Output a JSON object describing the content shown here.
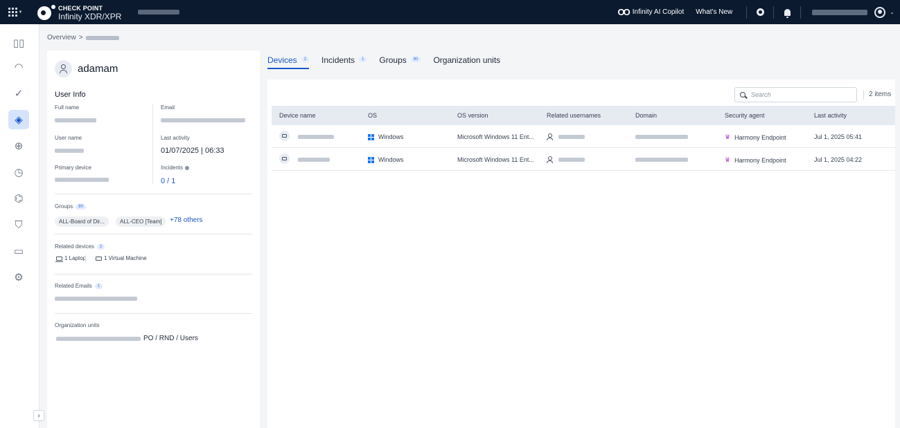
{
  "topbar": {
    "brand_name": "CHECK POINT",
    "product": "Infinity XDR/XPR",
    "copilot_label": "Infinity AI Copilot",
    "whats_new_label": "What's New"
  },
  "breadcrumb": {
    "root": "Overview",
    "separator": ">"
  },
  "user": {
    "name": "adamam",
    "info_title": "User Info",
    "labels": {
      "full_name": "Full name",
      "email": "Email",
      "user_name": "User name",
      "last_activity": "Last activity",
      "primary_device": "Primary device",
      "incidents": "Incidents"
    },
    "last_activity": "01/07/2025 | 06:33",
    "incidents_value": "0 / 1"
  },
  "groups": {
    "label": "Groups",
    "count": "80",
    "chips": [
      "ALL-Board of Dir...",
      "ALL-CEO [Team]"
    ],
    "others": "+78 others"
  },
  "related_devices": {
    "label": "Related devices",
    "count": "2",
    "laptop": "1 Laptop",
    "vm": "1 Virtual Machine"
  },
  "related_emails": {
    "label": "Related Emails",
    "count": "1"
  },
  "org_units": {
    "label": "Organization units",
    "path_suffix": "PO / RND / Users"
  },
  "tabs": [
    {
      "label": "Devices",
      "count": "2"
    },
    {
      "label": "Incidents",
      "count": "1"
    },
    {
      "label": "Groups",
      "count": "80"
    },
    {
      "label": "Organization units",
      "count": ""
    }
  ],
  "table": {
    "search_placeholder": "Search",
    "items_count": "2 items",
    "columns": [
      "Device name",
      "OS",
      "OS version",
      "Related usernames",
      "Domain",
      "Security agent",
      "Last activity"
    ],
    "rows": [
      {
        "os": "Windows",
        "os_version": "Microsoft Windows 11 Ent...",
        "agent": "Harmony Endpoint",
        "last_activity": "Jul 1, 2025 05:41"
      },
      {
        "os": "Windows",
        "os_version": "Microsoft Windows 11 Ent...",
        "agent": "Harmony Endpoint",
        "last_activity": "Jul 1, 2025 04:22"
      }
    ]
  },
  "colors": {
    "topbar_bg": "#0b1a2f",
    "accent": "#1a56c9",
    "windows_blue": "#1877f2",
    "harmony_purple": "#b23bd6"
  },
  "icons": {
    "rail": [
      "dashboard-icon",
      "gauge-icon",
      "check-circle-icon",
      "diamond-icon",
      "crosshair-icon",
      "clock-icon",
      "puzzle-icon",
      "shield-icon",
      "book-icon",
      "gear-icon"
    ]
  }
}
